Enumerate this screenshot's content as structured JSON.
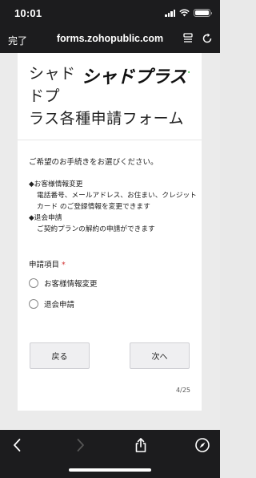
{
  "status": {
    "time": "10:01"
  },
  "browser": {
    "done_label": "完了",
    "url": "forms.zohopublic.com"
  },
  "form": {
    "title_line1": "シャド",
    "title_line2": "ドプ",
    "title_line3": "ラス各種申請フォーム",
    "logo_text": "シャドプラス+",
    "intro": "ご希望のお手続きをお選びください。",
    "items": [
      {
        "title": "◆お客様情報変更",
        "body": "電話番号、メールアドレス、お住まい、クレジットカード のご登録情報を変更できます"
      },
      {
        "title": "◆退会申請",
        "body": "ご契約プランの解約の申請ができます"
      }
    ],
    "field_label": "申請項目",
    "required_mark": "*",
    "options": [
      "お客様情報変更",
      "退会申請"
    ],
    "back_label": "戻る",
    "next_label": "次へ",
    "page_indicator": "4/25"
  },
  "colors": {
    "chrome": "#1c1c1e",
    "required": "#d23333",
    "logo_green": "#3ec04a"
  }
}
